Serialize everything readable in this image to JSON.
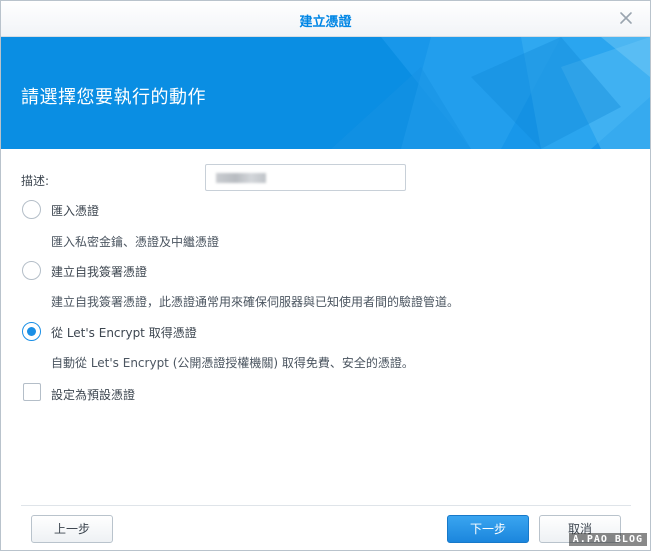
{
  "window": {
    "title": "建立憑證"
  },
  "banner": {
    "heading": "請選擇您要執行的動作"
  },
  "form": {
    "description_label": "描述:",
    "options": [
      {
        "label": "匯入憑證",
        "description": "匯入私密金鑰、憑證及中繼憑證",
        "selected": false
      },
      {
        "label": "建立自我簽署憑證",
        "description": "建立自我簽署憑證，此憑證通常用來確保伺服器與已知使用者間的驗證管道。",
        "selected": false
      },
      {
        "label": "從 Let's Encrypt 取得憑證",
        "description": "自動從 Let's Encrypt (公開憑證授權機關) 取得免費、安全的憑證。",
        "selected": true
      }
    ],
    "default_checkbox_label": "設定為預設憑證",
    "default_checked": false
  },
  "footer": {
    "back_label": "上一步",
    "next_label": "下一步",
    "cancel_label": "取消"
  },
  "watermark": "A.PAO BLOG",
  "colors": {
    "accent": "#0086e5",
    "banner": "#0a8ee3",
    "primary_button": "#1b86dd"
  }
}
